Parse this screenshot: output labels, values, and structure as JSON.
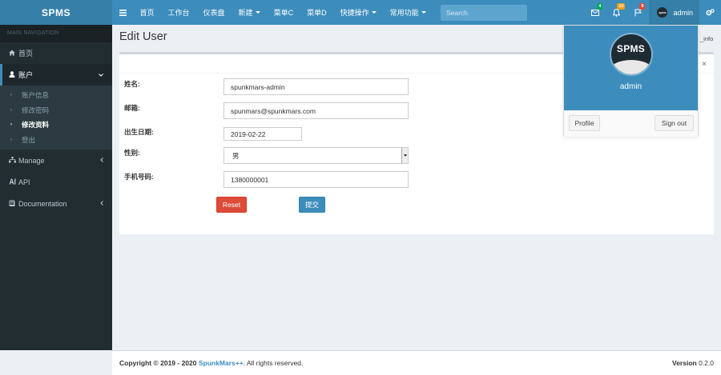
{
  "header": {
    "logo": "SPMS",
    "menu_icon": "hamburger-icon",
    "nav": [
      {
        "label": "首页",
        "dropdown": false
      },
      {
        "label": "工作台",
        "dropdown": false
      },
      {
        "label": "仪表盘",
        "dropdown": false
      },
      {
        "label": "新建",
        "dropdown": true
      },
      {
        "label": "菜单C",
        "dropdown": false
      },
      {
        "label": "菜单D",
        "dropdown": false
      },
      {
        "label": "快捷操作",
        "dropdown": true
      },
      {
        "label": "常用功能",
        "dropdown": true
      }
    ],
    "search_placeholder": "Search",
    "notifications": [
      {
        "icon": "envelope-icon",
        "count": "4",
        "color": "#00a65a"
      },
      {
        "icon": "bell-icon",
        "count": "10",
        "color": "#f39c12"
      },
      {
        "icon": "flag-icon",
        "count": "9",
        "color": "#dd4b39"
      }
    ],
    "user": "admin",
    "settings_icon": "gears-icon"
  },
  "sidebar": {
    "header": "MAIN NAVIGATION",
    "items": [
      {
        "label": "首页",
        "icon": "home-icon"
      },
      {
        "label": "账户",
        "icon": "user-icon",
        "expanded": true,
        "children": [
          "账户信息",
          "修改密码",
          "修改资料",
          "登出"
        ],
        "active_child": 2
      },
      {
        "label": "Manage",
        "icon": "sitemap-icon"
      },
      {
        "label": "API",
        "icon": "api-icon"
      },
      {
        "label": "Documentation",
        "icon": "book-icon"
      }
    ]
  },
  "main": {
    "title": "Edit User",
    "breadcrumb_fragment": "_info",
    "form": {
      "name_label": "姓名:",
      "name_value": "spunkmars-admin",
      "email_label": "邮箱:",
      "email_value": "spunmars@spunkmars.com",
      "birthday_label": "出生日期:",
      "birthday_value": "2019-02-22",
      "gender_label": "性别:",
      "gender_value": "男",
      "phone_label": "手机号码:",
      "phone_value": "1380000001",
      "reset_label": "Reset",
      "submit_label": "提交"
    }
  },
  "dropdown": {
    "avatar_text": "SPMS",
    "name": "admin",
    "profile_label": "Profile",
    "signout_label": "Sign out"
  },
  "footer": {
    "copyright_prefix": "Copyright © 2019 - 2020",
    "brand": "SpunkMars++",
    "rights": ". All rights reserved.",
    "version_label": "Version",
    "version_value": "0.2.0"
  },
  "colors": {
    "primary": "#3c8dbc",
    "sidebar_bg": "#222d32",
    "danger": "#dd4b39"
  }
}
